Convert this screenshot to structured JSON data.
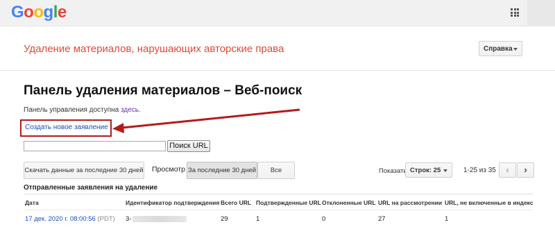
{
  "header": {
    "logo_letters": [
      {
        "char": "G",
        "color": "#4285f4"
      },
      {
        "char": "o",
        "color": "#ea4335"
      },
      {
        "char": "o",
        "color": "#fbbc05"
      },
      {
        "char": "g",
        "color": "#4285f4"
      },
      {
        "char": "l",
        "color": "#34a853"
      },
      {
        "char": "e",
        "color": "#ea4335"
      }
    ],
    "apps_icon": "apps-grid-icon"
  },
  "product": {
    "title": "Удаление материалов, нарушающих авторские права",
    "help_label": "Справка"
  },
  "main": {
    "page_title": "Панель удаления материалов – Веб-поиск",
    "dashboard_text": "Панель управления доступна ",
    "dashboard_link": "здесь.",
    "new_claim_link": "Создать новое заявление",
    "search": {
      "value": "",
      "button_label": "Поиск URL"
    }
  },
  "toolbar": {
    "download_label": "Скачать данные за последние 30 дней",
    "view_label": "Просмотр",
    "filter_30_label": "За последние 30 дней",
    "filter_all_label": "Все",
    "show_label": "Показать",
    "rows_label": "Строк: 25",
    "range_text": "1-25 из 35",
    "prev_icon": "‹",
    "next_icon": "›"
  },
  "table": {
    "caption": "Отправленные заявления на удаление",
    "columns": [
      "Дата",
      "Идентификатор подтверждения",
      "Всего URL",
      "Подтвержденные URL",
      "Отклоненные URL",
      "URL на рассмотрении",
      "URL, не включенные в индекс"
    ],
    "rows": [
      {
        "date": "17 дек. 2020 г. 08:00:56",
        "tz": "(PDT)",
        "id_prefix": "3-",
        "total": "29",
        "confirmed": "1",
        "rejected": "0",
        "pending": "27",
        "not_indexed": "1"
      }
    ]
  },
  "colors": {
    "product_title": "#dd4b39",
    "highlight_box": "#b31b1b",
    "link": "#1a4fb3",
    "visited_link": "#6a2fb0"
  }
}
